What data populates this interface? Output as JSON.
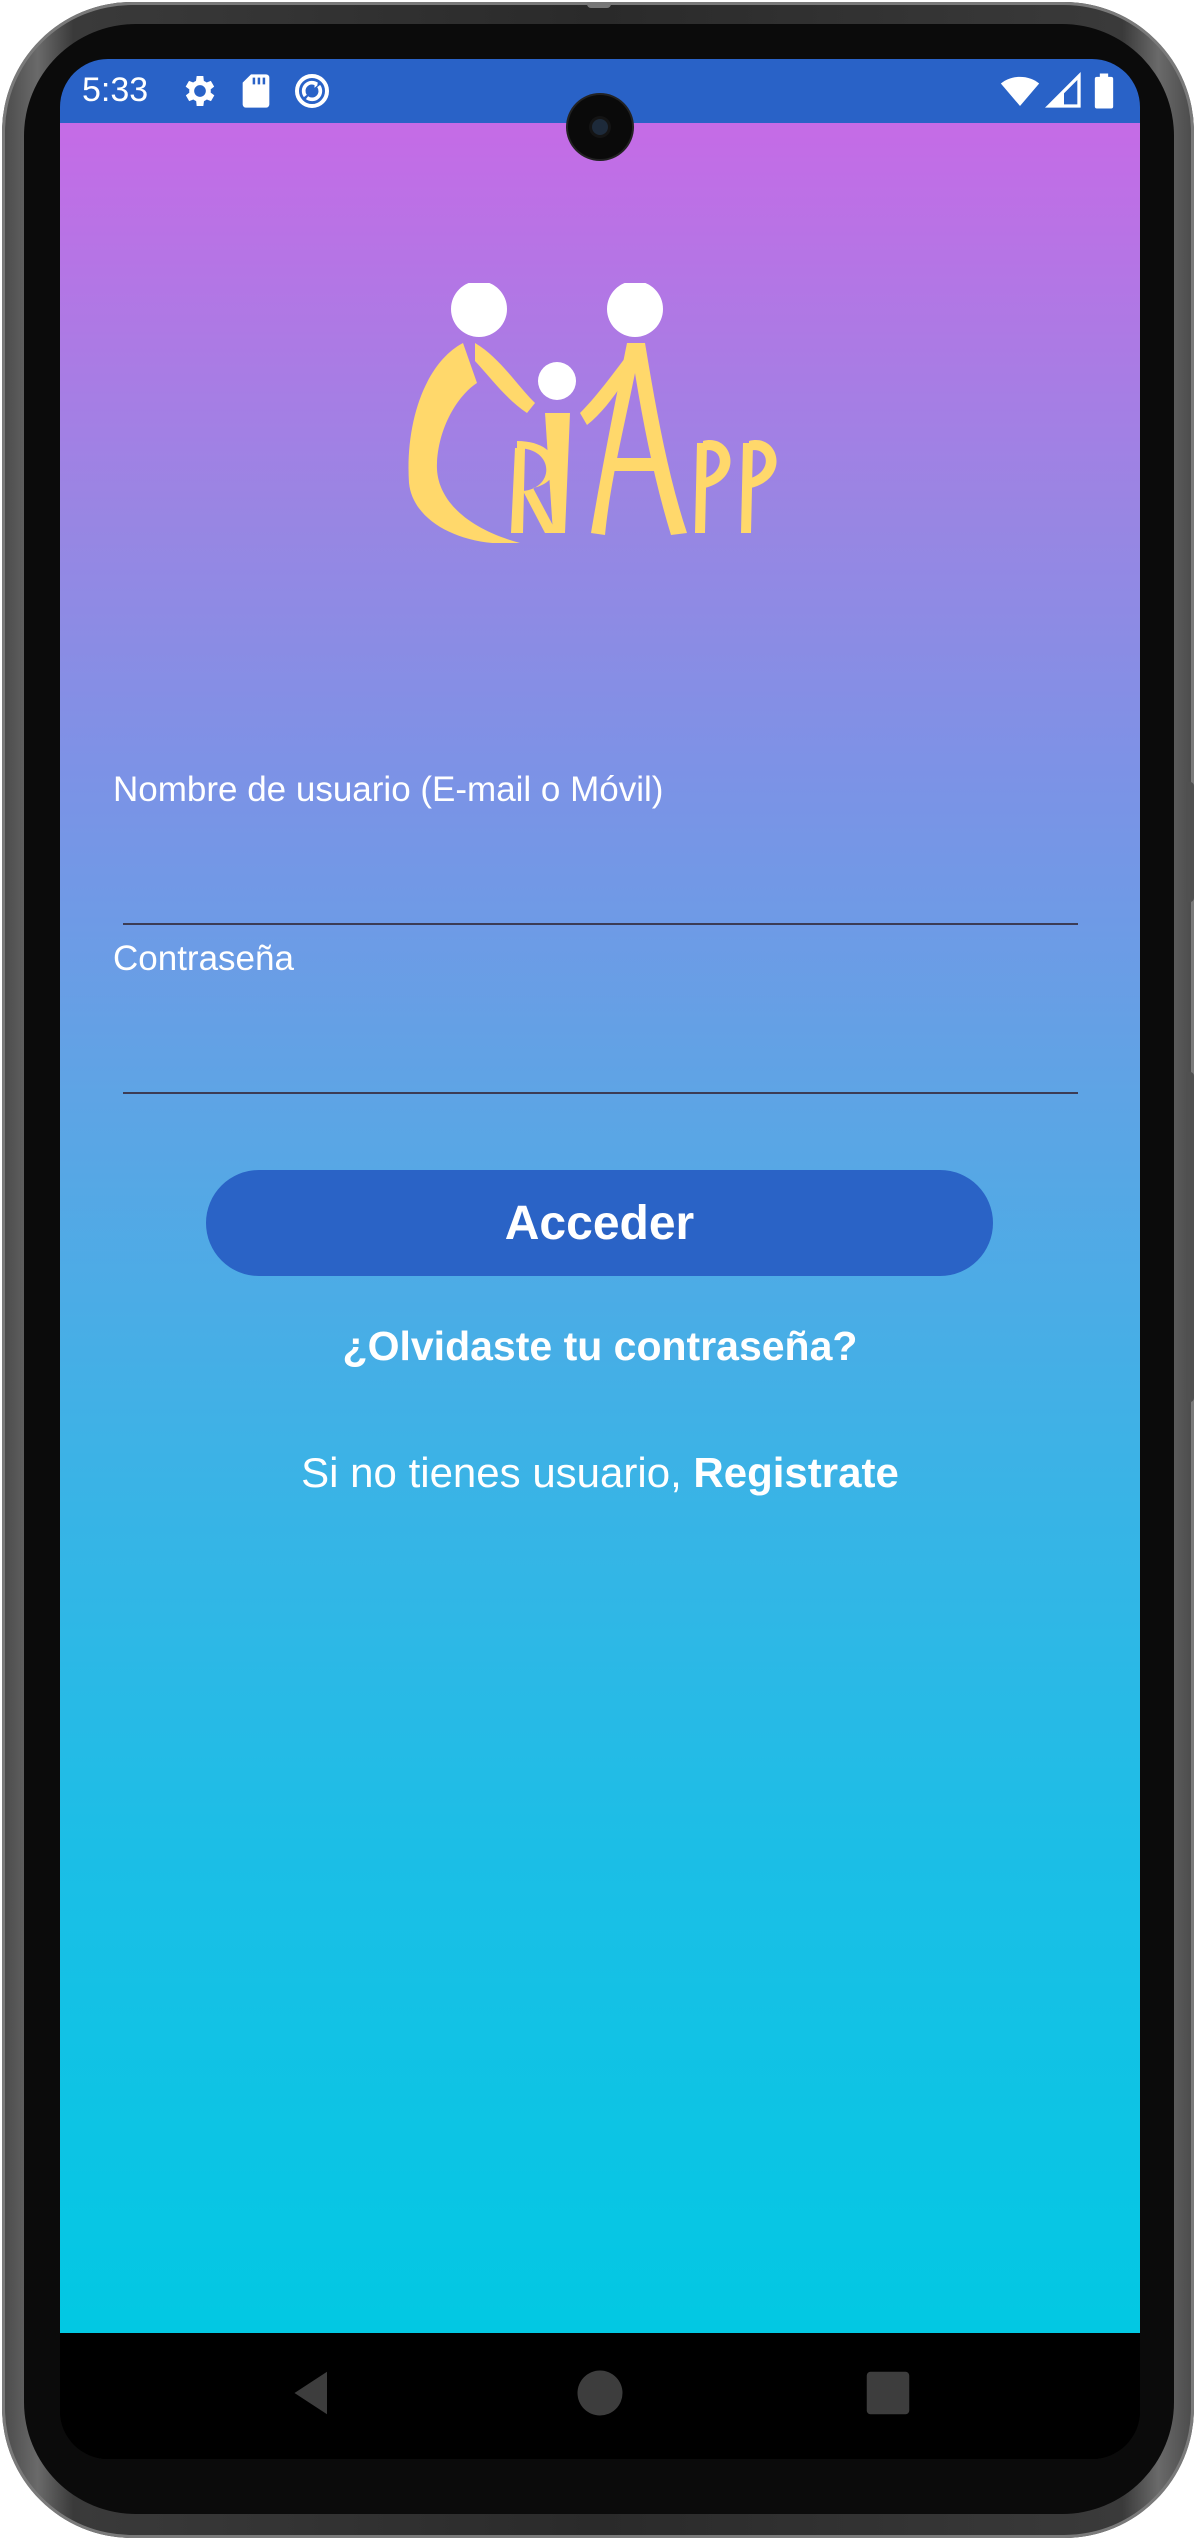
{
  "status_bar": {
    "time": "5:33",
    "left_icons": [
      "gear-icon",
      "sd-card-icon",
      "sync-icon"
    ],
    "right_icons": [
      "wifi-icon",
      "cell-signal-icon",
      "battery-icon"
    ],
    "color": "#2962c7"
  },
  "app": {
    "logo_text": "CriApp",
    "logo_color": "#ffd86b",
    "background_gradient": [
      "#c56be6",
      "#02c8e3"
    ]
  },
  "login_form": {
    "username_label": "Nombre de usuario (E-mail o Móvil)",
    "username_value": "",
    "password_label": "Contraseña",
    "password_value": "",
    "submit_label": "Acceder",
    "submit_color": "#2a63c6"
  },
  "links": {
    "forgot_password": "¿Olvidaste tu contraseña?",
    "register_prefix": "Si no tienes usuario, ",
    "register_link": "Registrate"
  },
  "nav_bar": {
    "buttons": [
      "back-icon",
      "home-icon",
      "recents-icon"
    ]
  }
}
